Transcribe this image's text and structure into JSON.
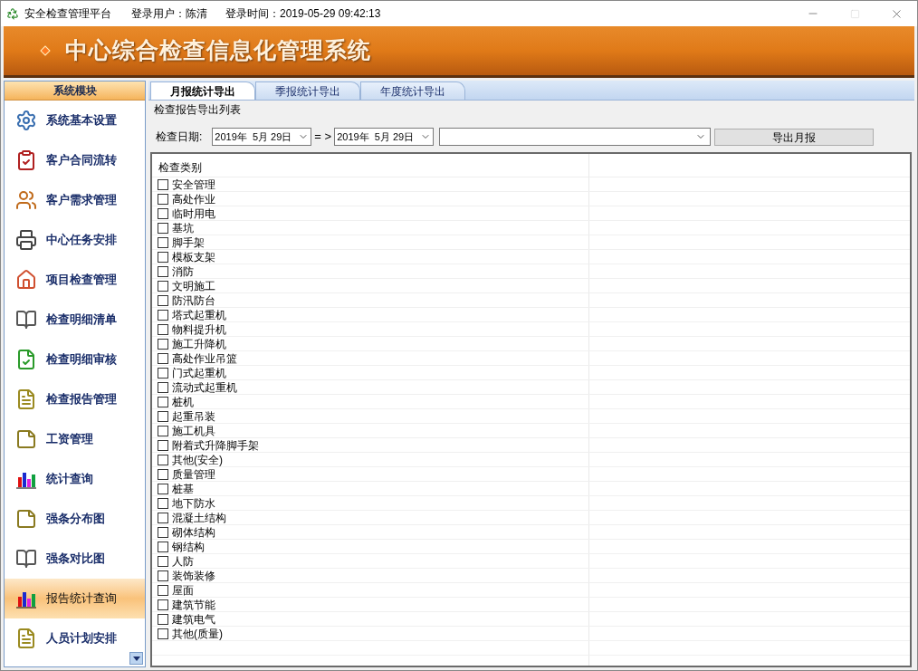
{
  "title_bar": {
    "app_name": "安全检查管理平台",
    "user": "登录用户：陈清",
    "login_time": "登录时间：2019-05-29 09:42:13"
  },
  "banner": {
    "title": "中心综合检查信息化管理系统"
  },
  "sidebar": {
    "header": "系统模块",
    "items": [
      {
        "label": "系统基本设置",
        "kind": "settings",
        "selected": false
      },
      {
        "label": "客户合同流转",
        "kind": "contract",
        "selected": false
      },
      {
        "label": "客户需求管理",
        "kind": "people",
        "selected": false
      },
      {
        "label": "中心任务安排",
        "kind": "task",
        "selected": false
      },
      {
        "label": "项目检查管理",
        "kind": "house",
        "selected": false
      },
      {
        "label": "检查明细清单",
        "kind": "book",
        "selected": false
      },
      {
        "label": "检查明细审核",
        "kind": "approve",
        "selected": false
      },
      {
        "label": "检查报告管理",
        "kind": "report",
        "selected": false
      },
      {
        "label": "工资管理",
        "kind": "note",
        "selected": false
      },
      {
        "label": "统计查询",
        "kind": "chart",
        "selected": false
      },
      {
        "label": "强条分布图",
        "kind": "note",
        "selected": false
      },
      {
        "label": "强条对比图",
        "kind": "book",
        "selected": false
      },
      {
        "label": "报告统计查询",
        "kind": "chart",
        "selected": true
      },
      {
        "label": "人员计划安排",
        "kind": "report",
        "selected": false
      }
    ]
  },
  "tabs": [
    {
      "label": "月报统计导出",
      "selected": true
    },
    {
      "label": "季报统计导出",
      "selected": false
    },
    {
      "label": "年度统计导出",
      "selected": false
    }
  ],
  "section_title": "检查报告导出列表",
  "filters": {
    "date_label": "检查日期:",
    "date_from": "2019年  5月 29日",
    "separator": "= >",
    "date_to": "2019年  5月 29日",
    "export_button": "导出月报"
  },
  "table": {
    "columns": [
      "检查类别"
    ],
    "rows": [
      {
        "label": "安全管理",
        "checked": false
      },
      {
        "label": "高处作业",
        "checked": false
      },
      {
        "label": "临时用电",
        "checked": false
      },
      {
        "label": "基坑",
        "checked": false
      },
      {
        "label": "脚手架",
        "checked": false
      },
      {
        "label": "模板支架",
        "checked": false
      },
      {
        "label": "消防",
        "checked": false
      },
      {
        "label": "文明施工",
        "checked": false
      },
      {
        "label": "防汛防台",
        "checked": false
      },
      {
        "label": "塔式起重机",
        "checked": false
      },
      {
        "label": "物料提升机",
        "checked": false
      },
      {
        "label": "施工升降机",
        "checked": false
      },
      {
        "label": "高处作业吊篮",
        "checked": false
      },
      {
        "label": "门式起重机",
        "checked": false
      },
      {
        "label": "流动式起重机",
        "checked": false
      },
      {
        "label": "桩机",
        "checked": false
      },
      {
        "label": "起重吊装",
        "checked": false
      },
      {
        "label": "施工机具",
        "checked": false
      },
      {
        "label": "附着式升降脚手架",
        "checked": false
      },
      {
        "label": "其他(安全)",
        "checked": false
      },
      {
        "label": "质量管理",
        "checked": false
      },
      {
        "label": "桩基",
        "checked": false
      },
      {
        "label": "地下防水",
        "checked": false
      },
      {
        "label": "混凝土结构",
        "checked": false
      },
      {
        "label": "砌体结构",
        "checked": false
      },
      {
        "label": "钢结构",
        "checked": false
      },
      {
        "label": "人防",
        "checked": false
      },
      {
        "label": "装饰装修",
        "checked": false
      },
      {
        "label": "屋面",
        "checked": false
      },
      {
        "label": "建筑节能",
        "checked": false
      },
      {
        "label": "建筑电气",
        "checked": false
      },
      {
        "label": "其他(质量)",
        "checked": false
      }
    ]
  }
}
